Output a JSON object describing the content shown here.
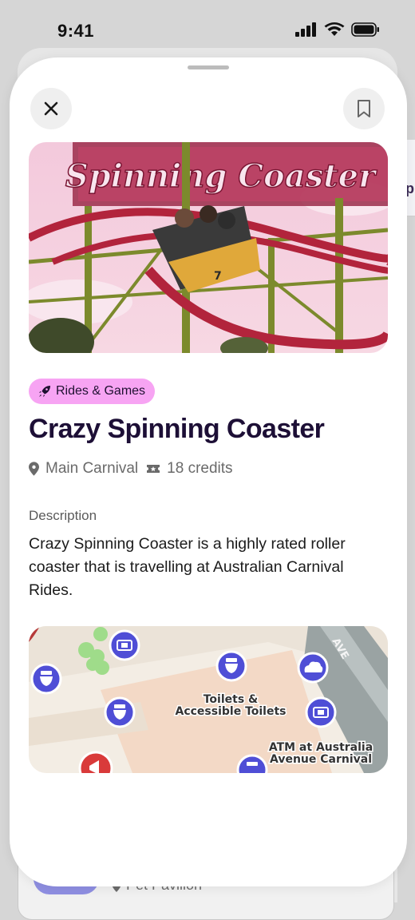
{
  "status_bar": {
    "time": "9:41"
  },
  "background": {
    "location_partial": "Pet Pavilion",
    "right_card_letter": "p"
  },
  "detail": {
    "category": "Rides & Games",
    "title": "Crazy Spinning Coaster",
    "location": "Main Carnival",
    "credits": "18 credits",
    "description_label": "Description",
    "description": "Crazy Spinning Coaster is a highly rated roller coaster that is travelling at Australian Carnival Rides."
  },
  "hero_image": {
    "sign_text": "Spinning Coaster",
    "car_number": "7"
  },
  "map": {
    "labels": {
      "toilets_line1": "Toilets &",
      "toilets_line2": "Accessible Toilets",
      "atm_line1": "ATM at Australia",
      "atm_line2": "Avenue Carnival",
      "street": "AVE"
    }
  },
  "colors": {
    "accent_pill": "#f7a4f3",
    "title": "#1d0f36",
    "map_pin": "#4f4ed6",
    "map_pin_red": "#d93a3a"
  },
  "icons": [
    "close-icon",
    "bookmark-icon",
    "rocket-icon",
    "location-pin-icon",
    "ticket-icon",
    "toilet-icon",
    "atm-icon",
    "cloud-icon",
    "megaphone-icon"
  ]
}
